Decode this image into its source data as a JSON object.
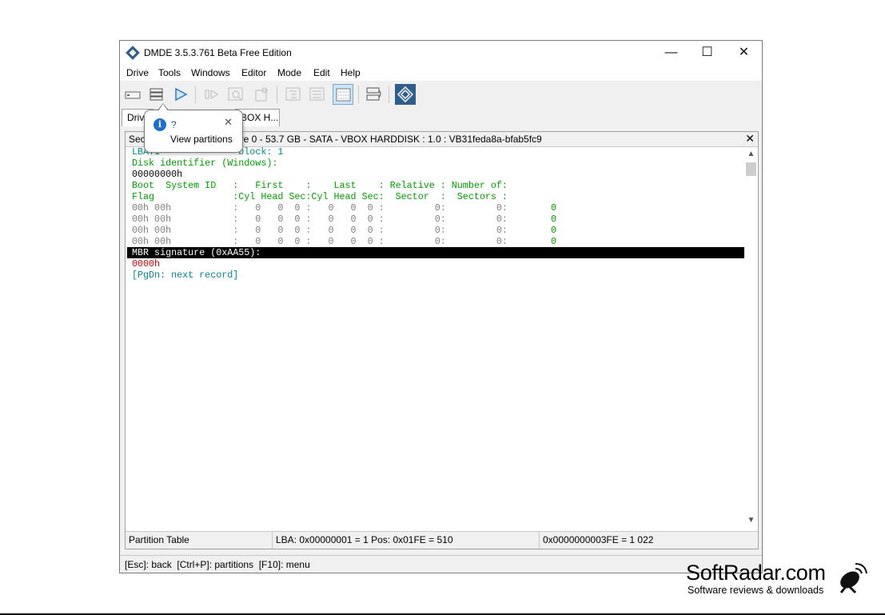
{
  "window": {
    "title": "DMDE 3.5.3.761 Beta Free Edition",
    "controls": {
      "minimize": "—",
      "maximize": "☐",
      "close": "✕"
    }
  },
  "menu": [
    "Drive",
    "Tools",
    "Windows",
    "Editor",
    "Mode",
    "Edit",
    "Help"
  ],
  "toolbar": {
    "buttons": [
      "drive-icon",
      "partitions-icon",
      "play-icon",
      "step-icon",
      "search-icon",
      "settings-icon",
      "tree-icon",
      "list-icon",
      "grid-icon",
      "log-icon",
      "app-logo-icon"
    ]
  },
  "tabs": [
    {
      "label": "Drive"
    },
    {
      "label": "BOX H..."
    }
  ],
  "panel": {
    "header_left": "Sect",
    "header_right": "ive 0 - 53.7 GB - SATA - VBOX HARDDISK : 1.0 : VB31feda8a-bfab5fc9",
    "close": "✕"
  },
  "content": {
    "lba_line": "LBA:1              block: 1",
    "disk_id_label": "Disk identifier (Windows):",
    "disk_id_value": "00000000h",
    "header1": "Boot  System ID   :   First    :    Last    : Relative : Number of:",
    "header2": "Flag              :Cyl Head Sec:Cyl Head Sec:  Sector  :  Sectors :",
    "rows": [
      {
        "left": "00h 00h           :   0   0  0 :   0   0  0 :         0:         0:",
        "value": "0"
      },
      {
        "left": "00h 00h           :   0   0  0 :   0   0  0 :         0:         0:",
        "value": "0"
      },
      {
        "left": "00h 00h           :   0   0  0 :   0   0  0 :         0:         0:",
        "value": "0"
      },
      {
        "left": "00h 00h           :   0   0  0 :   0   0  0 :         0:         0:",
        "value": "0"
      }
    ],
    "mbr_signature_label": "MBR signature (0xAA55):",
    "mbr_signature_value": "0000h",
    "next_record": "[PgDn: next record]"
  },
  "scroll": {
    "up": "▲",
    "down": "▼"
  },
  "status": {
    "left": "Partition Table",
    "middle": "LBA: 0x00000001 = 1  Pos: 0x01FE = 510",
    "right": "0x0000000003FE = 1 022"
  },
  "hotkeys": "[Esc]: back  [Ctrl+P]: partitions  [F10]: menu",
  "tooltip": {
    "title": "?",
    "text": "View partitions",
    "close": "✕"
  },
  "watermark": {
    "name": "SoftRadar.com",
    "tagline": "Software reviews & downloads"
  }
}
